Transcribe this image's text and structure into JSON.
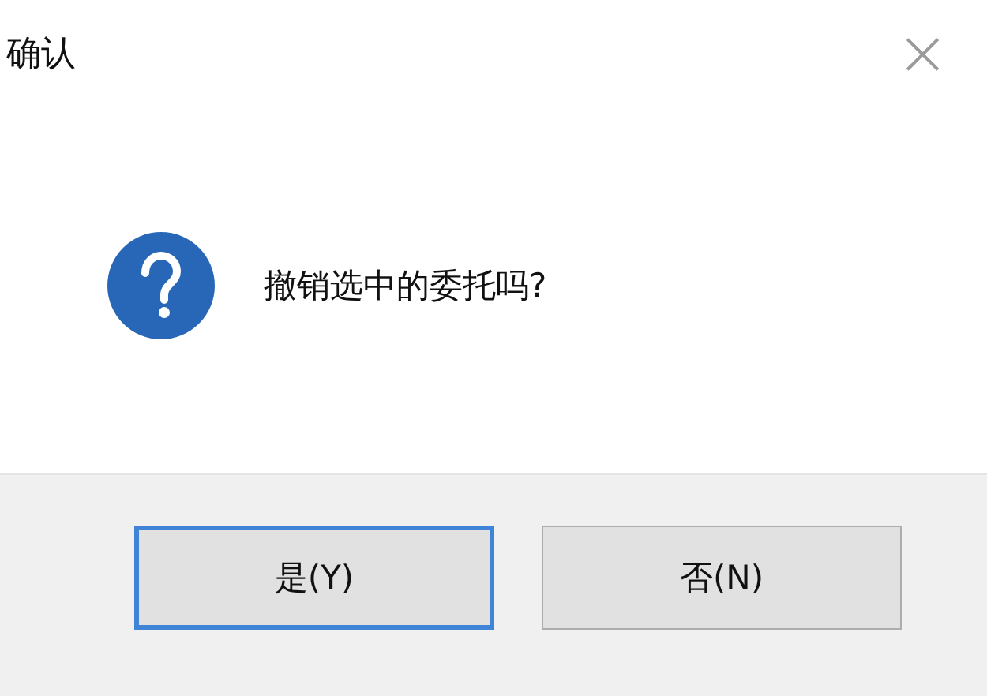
{
  "window": {
    "title": "确认",
    "close": "×"
  },
  "message": "撤销选中的委托吗?",
  "buttons": [
    {
      "label": "是(Y)",
      "selected": true
    },
    {
      "label": "否(N)",
      "selected": false
    }
  ]
}
